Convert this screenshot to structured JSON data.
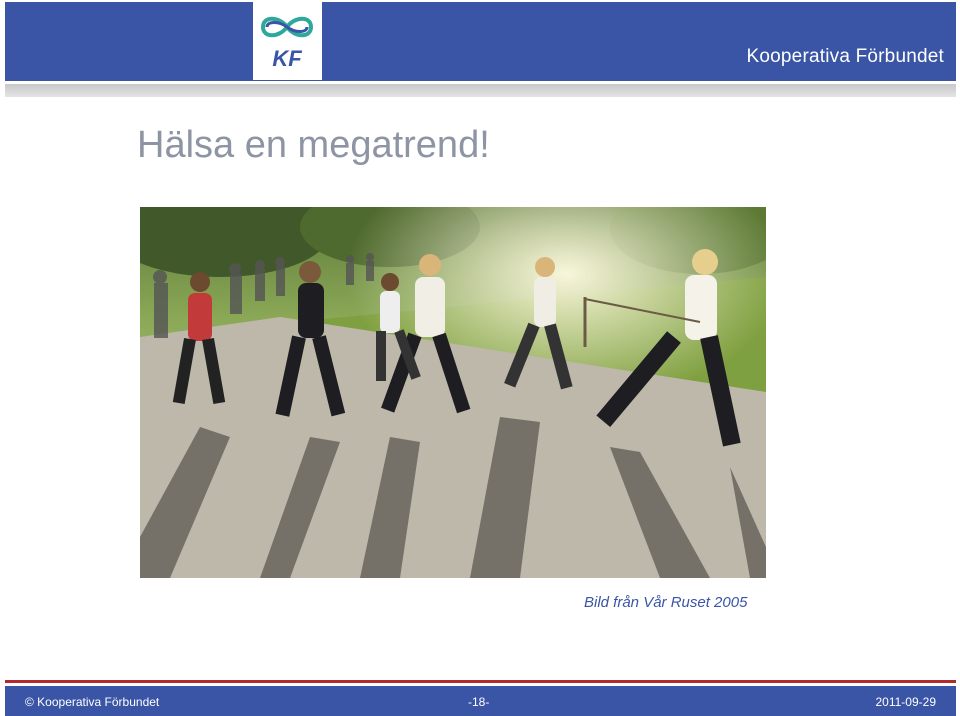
{
  "header": {
    "logo_text": "KF",
    "brand_name": "Kooperativa Förbundet",
    "accent_color": "#3a55a5",
    "logo_green": "#2ea89b"
  },
  "slide": {
    "title": "Hälsa en megatrend!",
    "image_icon": "photo-runners-race",
    "caption": "Bild från Vår Ruset 2005"
  },
  "footer": {
    "copyright": "© Kooperativa Förbundet",
    "page": "-18-",
    "date": "2011-09-29",
    "divider_color": "#b3282d"
  }
}
